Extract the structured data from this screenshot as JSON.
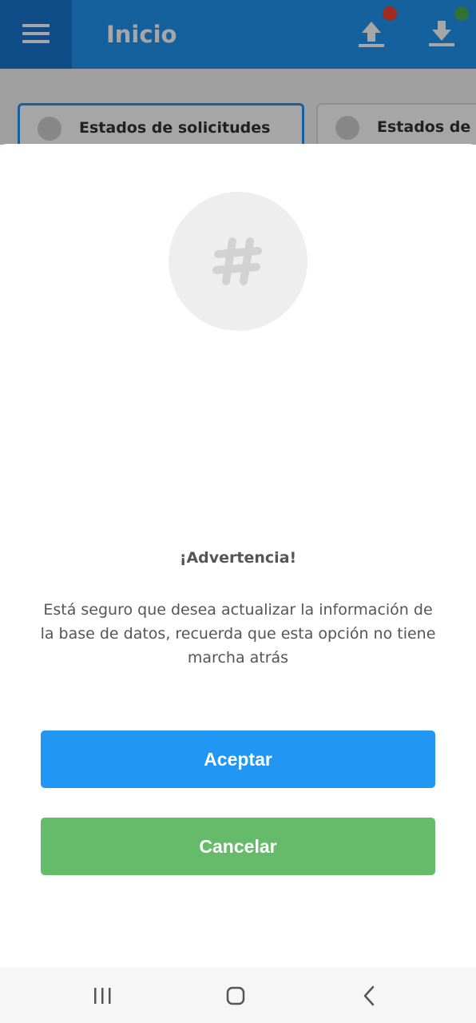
{
  "app_bar": {
    "title": "Inicio",
    "icons": {
      "menu": "hamburger-menu-icon",
      "upload": "upload-icon",
      "download": "download-icon"
    },
    "colors": {
      "bar": "#2196F3",
      "menu_bg": "#1976D2",
      "upload_status": "#F44336",
      "download_status": "#4CAF50"
    }
  },
  "tabs": [
    {
      "label": "Estados de solicitudes",
      "selected": true
    },
    {
      "label": "Estados de l",
      "selected": false
    }
  ],
  "dialog": {
    "icon": "hashtag-icon",
    "title": "¡Advertencia!",
    "message": "Está seguro que desea actualizar la información de la base de datos, recuerda que esta opción no tiene marcha atrás",
    "accept_label": "Aceptar",
    "cancel_label": "Cancelar",
    "colors": {
      "accept": "#2196F3",
      "cancel": "#66BB6A"
    }
  },
  "system_nav": {
    "recents": "recents-icon",
    "home": "home-icon",
    "back": "back-icon"
  }
}
